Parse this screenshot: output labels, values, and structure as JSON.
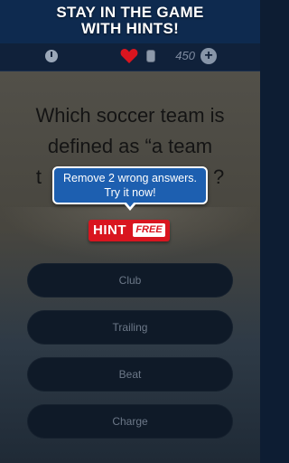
{
  "promo": {
    "line1": "STAY IN THE GAME",
    "line2": "WITH HINTS!"
  },
  "status": {
    "coins": "450",
    "add_label": "+"
  },
  "question": {
    "text": "Which soccer team is defined as “a team t... ?"
  },
  "hint": {
    "tooltip_line1": "Remove 2 wrong answers.",
    "tooltip_line2": "Try it now!",
    "label": "HINT",
    "badge": "FREE"
  },
  "answers": [
    {
      "label": "Club"
    },
    {
      "label": "Trailing"
    },
    {
      "label": "Beat"
    },
    {
      "label": "Charge"
    }
  ],
  "colors": {
    "accent_red": "#d9151f",
    "tooltip_blue": "#1d5fb0",
    "heart": "#d9151f"
  },
  "icons": [
    "timer-icon",
    "heart-icon",
    "coin-icon",
    "plus-icon"
  ]
}
